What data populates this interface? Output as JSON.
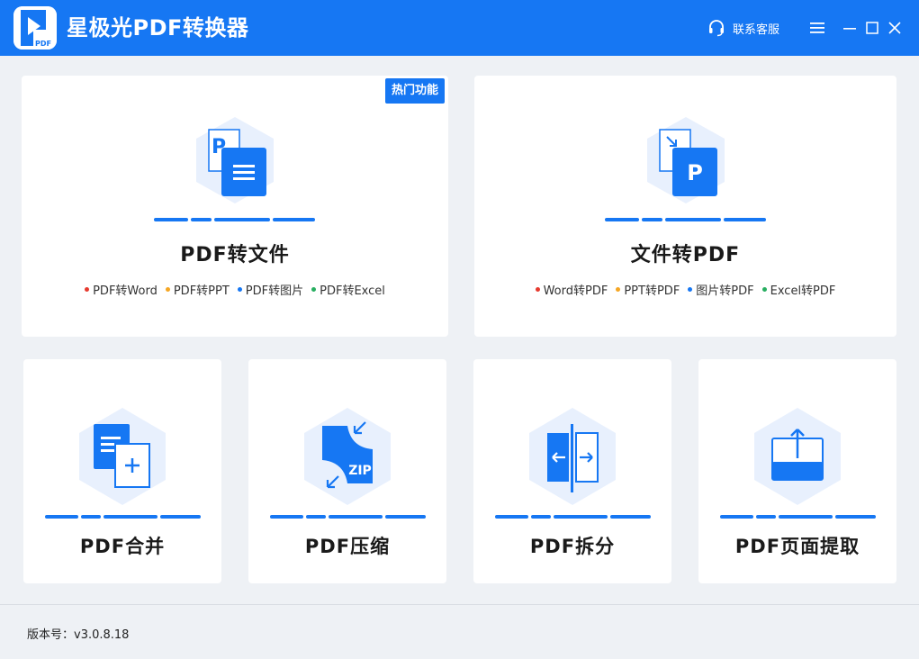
{
  "app": {
    "title": "星极光PDF转换器",
    "logo_text": "PDF",
    "support_label": "联系客服"
  },
  "colors": {
    "brand": "#1677f3",
    "dot_red": "#e63a2e",
    "dot_orange": "#f5a623",
    "dot_blue": "#1677f3",
    "dot_green": "#27ae60"
  },
  "cards": {
    "pdf_to_file": {
      "title": "PDF转文件",
      "badge": "热门功能",
      "features": [
        "PDF转Word",
        "PDF转PPT",
        "PDF转图片",
        "PDF转Excel"
      ]
    },
    "file_to_pdf": {
      "title": "文件转PDF",
      "features": [
        "Word转PDF",
        "PPT转PDF",
        "图片转PDF",
        "Excel转PDF"
      ]
    },
    "merge": {
      "title": "PDF合并"
    },
    "compress": {
      "title": "PDF压缩",
      "icon_text": "ZIP"
    },
    "split": {
      "title": "PDF拆分"
    },
    "extract": {
      "title": "PDF页面提取"
    }
  },
  "icons": {
    "pdf_to_file_icon_letter": "P",
    "file_to_pdf_icon_letter": "P"
  },
  "footer": {
    "version": "版本号：v3.0.8.18"
  }
}
